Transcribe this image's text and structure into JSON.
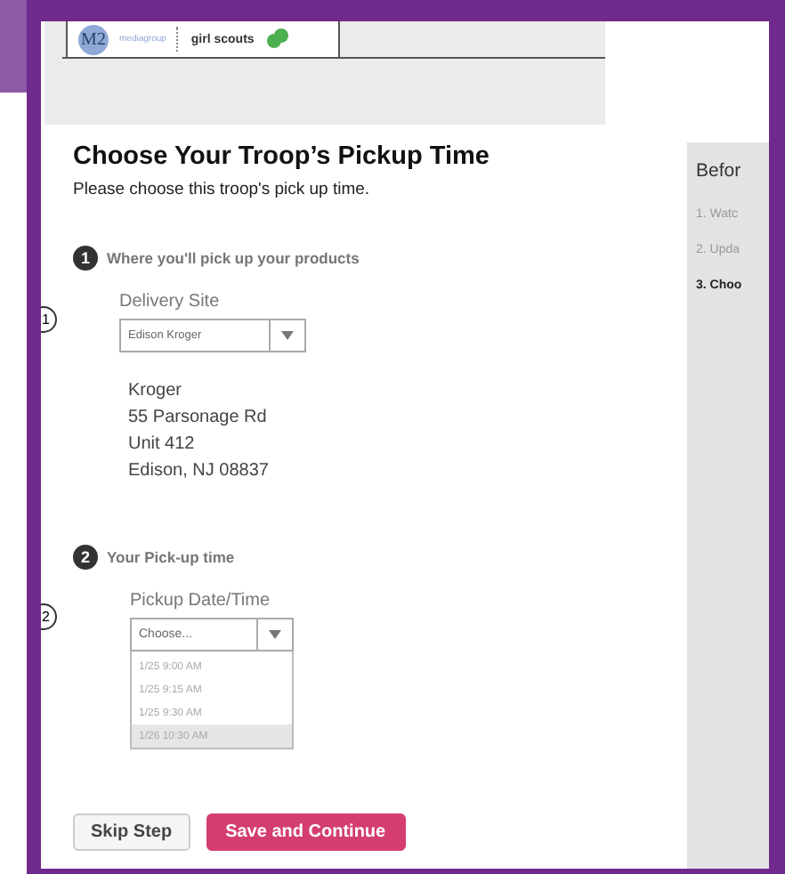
{
  "header": {
    "logo_mark": "M2",
    "logo_text": "mediagroup",
    "partner": "girl scouts"
  },
  "title": "Choose Your Troop’s Pickup Time",
  "subtitle": "Please choose this troop's pick up time.",
  "sections": [
    {
      "step": "1",
      "heading": "Where you'll pick up your products",
      "field_label": "Delivery Site",
      "value": "Edison Kroger",
      "kind": "site",
      "address": [
        "Kroger",
        "55 Parsonage Rd",
        "Unit 412",
        "Edison, NJ 08837"
      ],
      "callout": "1"
    },
    {
      "step": "2",
      "heading": "Your Pick-up time",
      "field_label": "Pickup Date/Time",
      "value": "Choose...",
      "kind": "time",
      "options": [
        {
          "label": "1/25 9:00 AM",
          "selected": false
        },
        {
          "label": "1/25 9:15 AM",
          "selected": false
        },
        {
          "label": "1/25 9:30 AM",
          "selected": false
        },
        {
          "label": "1/26 10:30 AM",
          "selected": true
        }
      ],
      "callout": "2"
    }
  ],
  "buttons": {
    "skip": "Skip Step",
    "save": "Save and Continue"
  },
  "sidebar": {
    "heading": "Befor",
    "steps": [
      {
        "label": "1. Watc",
        "selected": false
      },
      {
        "label": "2. Upda",
        "selected": false
      },
      {
        "label": "3. Choo",
        "selected": true
      }
    ]
  }
}
